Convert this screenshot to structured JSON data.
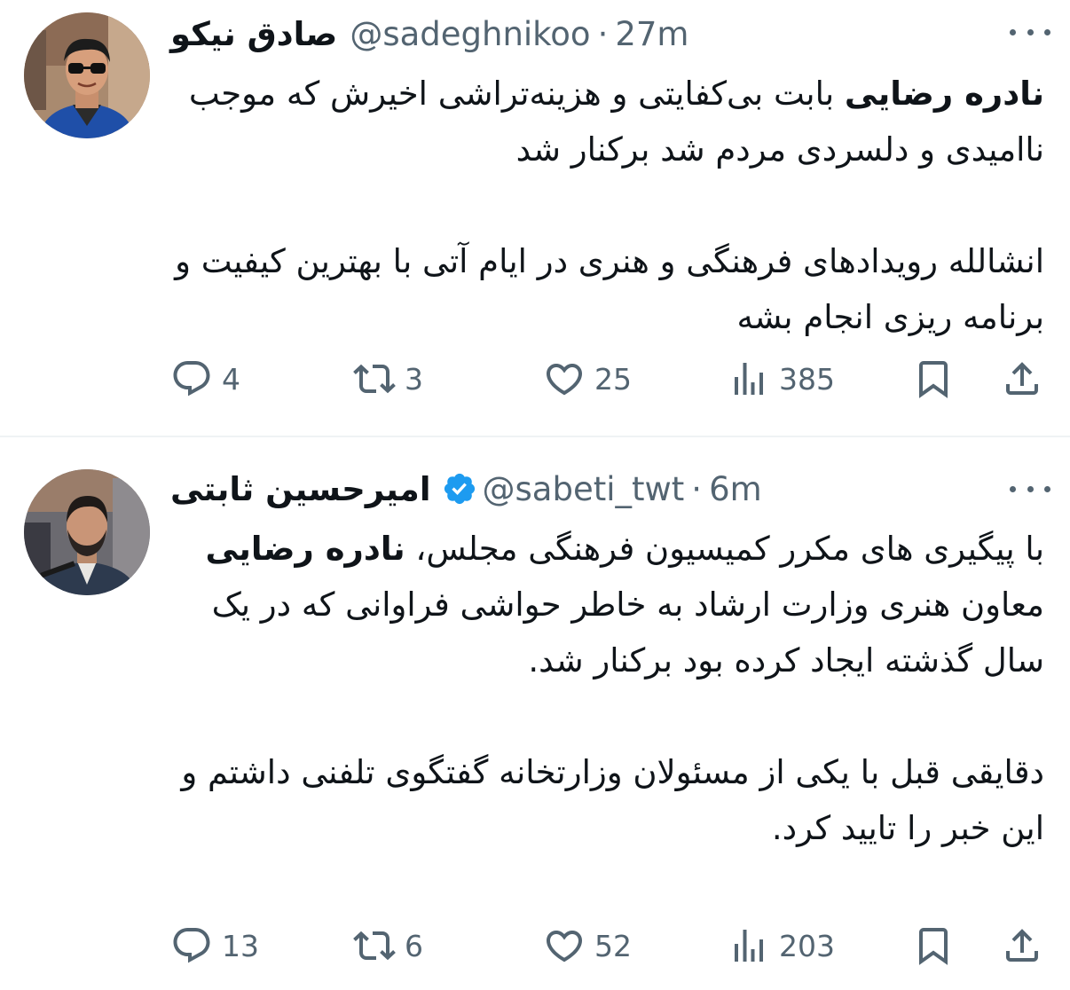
{
  "tweets": [
    {
      "display_name": "صادق نیکو",
      "handle": "@sadeghnikoo",
      "separator": "·",
      "time": "27m",
      "verified": false,
      "paragraphs": [
        [
          {
            "text": "نادره رضایی",
            "bold": true
          },
          {
            "text": " بابت بی‌کفایتی و هزینه‌تراشی اخیرش که موجب ناامیدی و دلسردی مردم شد برکنار شد",
            "bold": false
          }
        ],
        [
          {
            "text": "انشالله رویدادهای فرهنگی و هنری در ایام آتی با بهترین کیفیت و برنامه ریزی انجام بشه",
            "bold": false
          }
        ]
      ],
      "replies": "4",
      "retweets": "3",
      "likes": "25",
      "views": "385"
    },
    {
      "display_name": "امیرحسین ثابتی",
      "handle": "@sabeti_twt",
      "separator": "·",
      "time": "6m",
      "verified": true,
      "paragraphs": [
        [
          {
            "text": "با پیگیری های مکرر کمیسیون فرهنگی مجلس، ",
            "bold": false
          },
          {
            "text": "نادره رضایی",
            "bold": true
          },
          {
            "text": " معاون هنری وزارت ارشاد به خاطر حواشی فراوانی که در یک سال گذشته ایجاد کرده بود برکنار شد.",
            "bold": false
          }
        ],
        [
          {
            "text": "دقایقی قبل با یکی از مسئولان وزارتخانه گفتگوی تلفنی داشتم و این خبر را تایید کرد.",
            "bold": false
          }
        ]
      ],
      "replies": "13",
      "retweets": "6",
      "likes": "52",
      "views": "203"
    }
  ],
  "icons": {
    "reply": "reply-icon",
    "retweet": "retweet-icon",
    "like": "heart-icon",
    "views": "views-icon",
    "bookmark": "bookmark-icon",
    "share": "share-icon",
    "more": "more-icon",
    "verified": "verified-badge-icon"
  },
  "colors": {
    "text": "#0f1419",
    "secondary": "#536471",
    "verified": "#1d9bf0",
    "divider": "#eff3f4"
  }
}
